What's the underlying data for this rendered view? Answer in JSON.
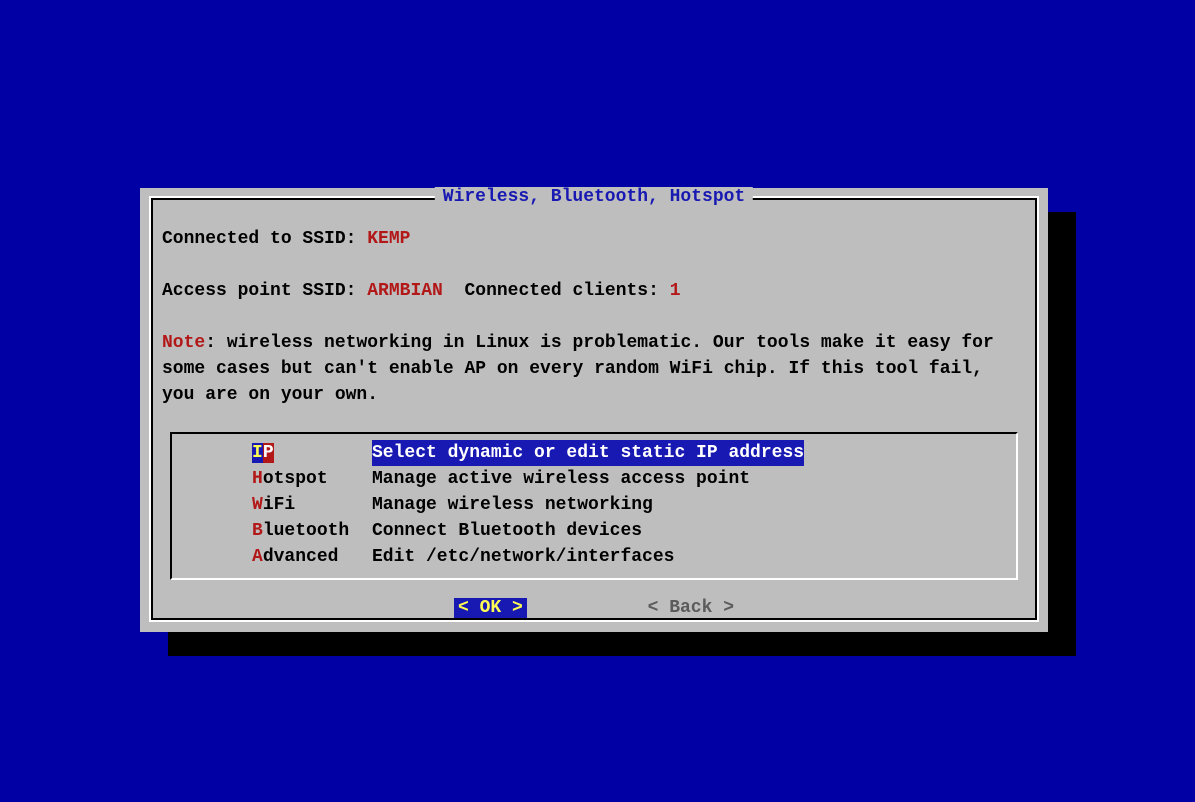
{
  "dialog": {
    "title": " Wireless, Bluetooth, Hotspot ",
    "connected_label": "Connected to SSID: ",
    "connected_ssid": "KEMP",
    "ap_label": "Access point SSID: ",
    "ap_ssid": "ARMBIAN",
    "clients_label": "  Connected clients: ",
    "clients_count": "1",
    "note_label": "Note",
    "note_text": ": wireless networking in Linux is problematic. Our tools make it easy for some cases but can't enable AP on every random WiFi chip. If this tool fail, you are on your own.",
    "menu": [
      {
        "fl": "I",
        "rest": "P",
        "desc": "Select dynamic or edit static IP address",
        "selected": true
      },
      {
        "fl": "H",
        "rest": "otspot",
        "desc": "Manage active wireless access point",
        "selected": false
      },
      {
        "fl": "W",
        "rest": "iFi",
        "desc": "Manage wireless networking",
        "selected": false
      },
      {
        "fl": "B",
        "rest": "luetooth",
        "desc": "Connect Bluetooth devices",
        "selected": false
      },
      {
        "fl": "A",
        "rest": "dvanced",
        "desc": "Edit /etc/network/interfaces",
        "selected": false
      }
    ],
    "ok_button": "<  OK  >",
    "back_button": "< Back >"
  }
}
